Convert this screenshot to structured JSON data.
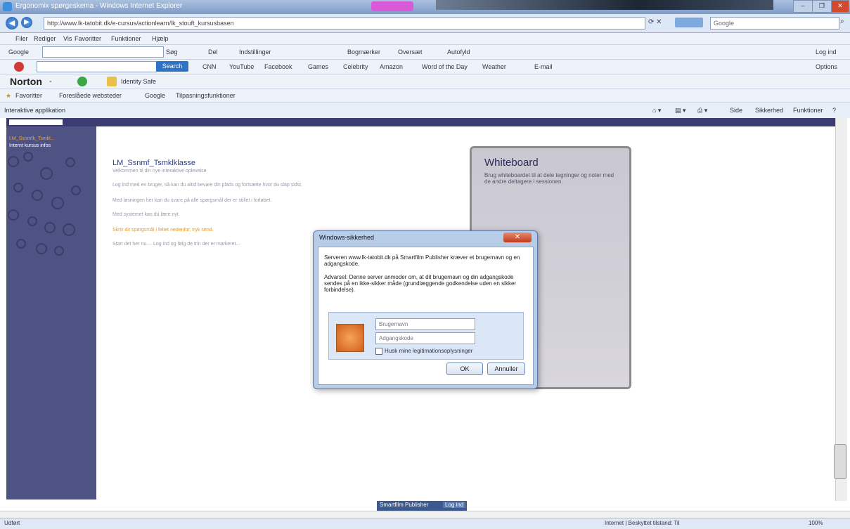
{
  "window": {
    "title": "Ergonomix spørgeskema - Windows Internet Explorer",
    "controls": [
      "–",
      "❐",
      "✕"
    ]
  },
  "address_bar": {
    "url": "http://www.lk-tatobit.dk/e-cursus/actionlearn/lk_stouft_kursusbasen",
    "search_placeholder": "Google"
  },
  "menu": [
    "Filer",
    "Rediger",
    "Vis",
    "Favoritter",
    "Funktioner",
    "Hjælp"
  ],
  "google_toolbar": {
    "label": "Google",
    "items": [
      "Søg",
      "Del",
      "Indstillinger",
      "Bogmærker",
      "Oversæt",
      "Autofyld"
    ],
    "right": "Log ind"
  },
  "second_toolbar": {
    "search_button": "Search",
    "items": [
      "CNN",
      "YouTube",
      "Facebook",
      "Games",
      "Celebrity",
      "Amazon",
      "Word of the Day",
      "Weather",
      "E-mail"
    ],
    "right": "Options"
  },
  "norton_toolbar": {
    "brand": "Norton",
    "dash": "-",
    "item": "Identity Safe"
  },
  "favorites_bar": {
    "label": "Favoritter",
    "items": [
      "Foreslåede websteder",
      "Google",
      "Tilpasningsfunktioner"
    ]
  },
  "tab": {
    "label": "Interaktive applikation",
    "right_tools": [
      "Side",
      "Sikkerhed",
      "Funktioner"
    ]
  },
  "sidebar": {
    "items": [
      "LM_Ssnmfk_Tsmkl...",
      "Internt kursus infos"
    ]
  },
  "content": {
    "heading": "LM_Ssnmf_Tsmklklasse",
    "subheading": "Velkommen til din nye interaktive oplevelse",
    "paragraphs": [
      "Log ind med en bruger, så kan du altid bevare din plads og fortsætte hvor du slap sidst.",
      "Med løsningen her kan du svare på alle spørgsmål der er stillet i forløbet.",
      "Med systemet kan du lære nyt.",
      "Skriv dit spørgsmål i feltet nedenfor, tryk send.",
      "Start det her nu.... Log ind og følg de trin der er markeret..."
    ]
  },
  "whiteboard": {
    "title": "Whiteboard",
    "text": "Brug whiteboardet til at dele tegninger og noter med de andre deltagere i sessionen."
  },
  "dialog": {
    "title": "Windows-sikkerhed",
    "close": "✕",
    "text1": "Serveren www.lk-tatobit.dk på Smartfilm Publisher kræver et brugernavn og en adgangskode.",
    "text2": "Advarsel: Denne server anmoder om, at dit brugernavn og din adgangskode sendes på en ikke-sikker måde (grundlæggende godkendelse uden en sikker forbindelse).",
    "username_placeholder": "Brugernavn",
    "password_placeholder": "Adgangskode",
    "remember_label": "Husk mine legitimationsoplysninger",
    "ok": "OK",
    "cancel": "Annuller"
  },
  "bottom_bar": {
    "button1": "Smartfilm Publisher",
    "button2": "Log ind"
  },
  "status_bar": {
    "left": "Udført",
    "zone": "Internet | Beskyttet tilstand: Til",
    "zoom": "100%"
  }
}
